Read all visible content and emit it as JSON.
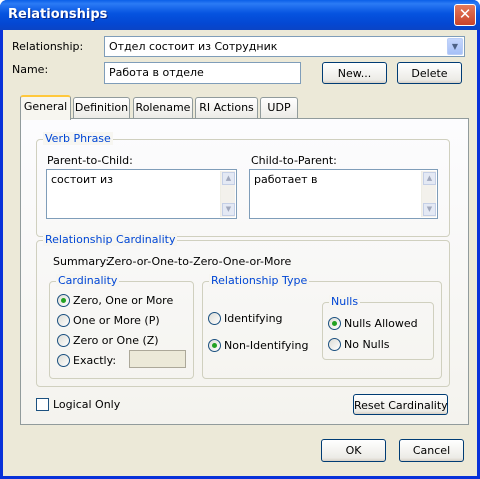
{
  "window": {
    "title": "Relationships",
    "close": "✕"
  },
  "relationship": {
    "label": "Relationship:",
    "value": "Отдел состоит из Сотрудник",
    "arrow": "▼"
  },
  "name": {
    "label": "Name:",
    "value": "Работа в отделе"
  },
  "buttons": {
    "new": "New...",
    "delete": "Delete",
    "reset": "Reset Cardinality",
    "ok": "OK",
    "cancel": "Cancel"
  },
  "tabs": [
    "General",
    "Definition",
    "Rolename",
    "RI Actions",
    "UDP"
  ],
  "verb_phrase": {
    "title": "Verb Phrase",
    "parent_label": "Parent-to-Child:",
    "parent_value": "состоит из",
    "child_label": "Child-to-Parent:",
    "child_value": "работает в"
  },
  "cardinality_group": {
    "title": "Relationship Cardinality",
    "summary_label": "Summary:",
    "summary_value": "Zero-or-One-to-Zero-One-or-More"
  },
  "cardinality": {
    "title": "Cardinality",
    "options": [
      "Zero, One or More",
      "One or More (P)",
      "Zero or One (Z)",
      "Exactly:"
    ],
    "selected": 0,
    "exactly_value": ""
  },
  "rel_type": {
    "title": "Relationship Type",
    "identifying": "Identifying",
    "non_identifying": "Non-Identifying",
    "selected": "non_identifying"
  },
  "nulls": {
    "title": "Nulls",
    "allowed": "Nulls Allowed",
    "none": "No Nulls",
    "selected": "allowed"
  },
  "logical_only": {
    "label": "Logical Only",
    "checked": false
  },
  "scroll_icons": {
    "up": "▲",
    "down": "▼"
  },
  "colors": {
    "title_bar": "#0553e0",
    "group_title": "#0046d5",
    "radio_dot": "#21a121"
  }
}
